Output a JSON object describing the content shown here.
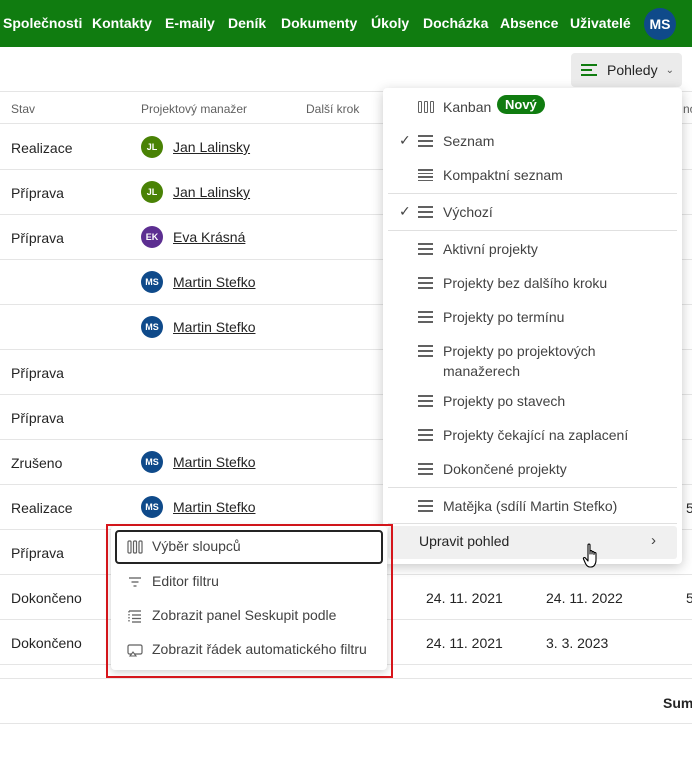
{
  "nav": {
    "items": [
      "Společnosti",
      "Kontakty",
      "E-maily",
      "Deník",
      "Dokumenty",
      "Úkoly",
      "Docházka",
      "Absence",
      "Uživatelé"
    ],
    "user_initials": "MS"
  },
  "toolbar": {
    "views_label": "Pohledy"
  },
  "table": {
    "headers": {
      "stav": "Stav",
      "manager": "Projektový manažer",
      "next_step": "Další krok",
      "clipped": "no"
    },
    "rows": [
      {
        "stav": "Realizace",
        "initials": "JL",
        "manager": "Jan Lalinsky",
        "avatar_color": "#498205"
      },
      {
        "stav": "Příprava",
        "initials": "JL",
        "manager": "Jan Lalinsky",
        "avatar_color": "#498205"
      },
      {
        "stav": "Příprava",
        "initials": "EK",
        "manager": "Eva Krásná",
        "avatar_color": "#5c2e91"
      },
      {
        "stav": "",
        "initials": "MS",
        "manager": "Martin Stefko",
        "avatar_color": "#0f4a8a"
      },
      {
        "stav": "",
        "initials": "MS",
        "manager": "Martin Stefko",
        "avatar_color": "#0f4a8a"
      },
      {
        "stav": "Příprava",
        "initials": "",
        "manager": "",
        "avatar_color": ""
      },
      {
        "stav": "Příprava",
        "initials": "",
        "manager": "",
        "avatar_color": ""
      },
      {
        "stav": "Zrušeno",
        "initials": "MS",
        "manager": "Martin Stefko",
        "avatar_color": "#0f4a8a"
      },
      {
        "stav": "Realizace",
        "initials": "MS",
        "manager": "Martin Stefko",
        "avatar_color": "#0f4a8a",
        "far": "5"
      },
      {
        "stav": "Příprava",
        "initials": "",
        "manager": "",
        "avatar_color": ""
      },
      {
        "stav": "Dokončeno",
        "initials": "",
        "manager": "",
        "avatar_color": "",
        "date1": "24. 11. 2021",
        "date2": "24. 11. 2022",
        "far": "5"
      },
      {
        "stav": "Dokončeno",
        "initials": "",
        "manager": "",
        "avatar_color": "",
        "date1": "24. 11. 2021",
        "date2": "3. 3. 2023"
      }
    ],
    "sum_label": "Sum"
  },
  "views_menu": {
    "kanban": "Kanban",
    "new_badge": "Nový",
    "seznam": "Seznam",
    "kompaktni": "Kompaktní seznam",
    "vychozi": "Výchozí",
    "views": [
      "Aktivní projekty",
      "Projekty bez dalšího kroku",
      "Projekty po termínu",
      "Projekty po projektových manažerech",
      "Projekty po stavech",
      "Projekty čekající na zaplacení",
      "Dokončené projekty"
    ],
    "shared": "Matějka (sdílí Martin Stefko)",
    "edit_view": "Upravit pohled",
    "check": "✓"
  },
  "submenu": {
    "columns": "Výběr sloupců",
    "filter_editor": "Editor filtru",
    "group_panel": "Zobrazit panel Seskupit podle",
    "auto_filter_row": "Zobrazit řádek automatického filtru"
  },
  "colors": {
    "brand": "#107c10",
    "highlight": "#d9161c"
  }
}
